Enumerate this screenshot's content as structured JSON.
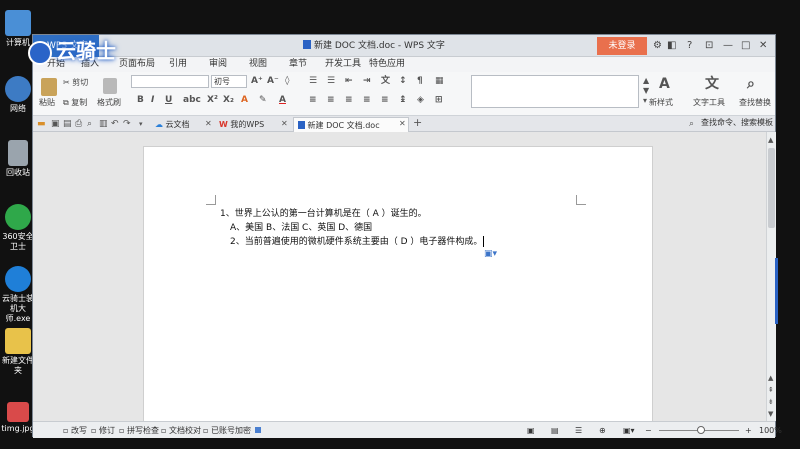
{
  "desktop": {
    "icons": [
      {
        "label": "计算机",
        "color": "#4a8fd6"
      },
      {
        "label": "网络",
        "color": "#3d7bc4"
      },
      {
        "label": "回收站",
        "color": "#9aa4ad"
      },
      {
        "label": "360安全卫士",
        "color": "#2fa84a"
      },
      {
        "label": "云骑士装机大师.exe",
        "color": "#1f7fd8"
      },
      {
        "label": "新建文件夹",
        "color": "#e8c24a"
      },
      {
        "label": "timg.jpg",
        "color": "#d94a4a"
      }
    ],
    "watermark": "云骑士"
  },
  "window": {
    "app_button": "WPS 文字",
    "doc_title": "新建 DOC 文档.doc - WPS 文字",
    "login_button": "未登录",
    "controls": {
      "min": "—",
      "max": "□",
      "close": "✕"
    },
    "menus": [
      "开始",
      "插入",
      "页面布局",
      "引用",
      "审阅",
      "视图",
      "章节",
      "开发工具",
      "特色应用"
    ],
    "ribbon": {
      "paste": "粘贴",
      "cut": "剪切",
      "copy": "复制",
      "format_painter": "格式刷",
      "font_name": "",
      "font_size": "初号",
      "new_style": "新样式",
      "text_tools": "文字工具",
      "find_replace": "查找替换"
    },
    "tabs": [
      {
        "label": "云文档",
        "icon_color": "#2a7fd8"
      },
      {
        "label": "我的WPS",
        "icon_color": "#d9362b"
      },
      {
        "label": "新建 DOC 文档.doc",
        "icon_color": "#2a62c4",
        "active": true
      }
    ],
    "tab_add": "+",
    "search_cmd": "查找命令、搜索模板",
    "document": {
      "lines": [
        "1、世界上公认的第一台计算机是在（ A ）诞生的。",
        "A、美国 B、法国 C、英国 D、德国",
        "2、当前普遍使用的微机硬件系统主要由（ D ）电子器件构成。"
      ]
    },
    "status": {
      "items": [
        "改写",
        "修订",
        "拼写检查",
        "文档校对",
        "已账号加密"
      ],
      "zoom": "100%"
    }
  }
}
